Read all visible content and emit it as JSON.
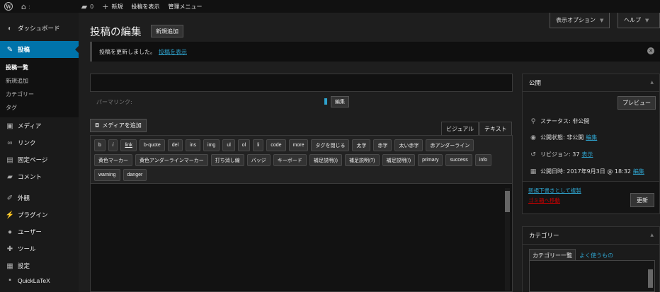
{
  "adminbar": {
    "home_icon": "home-icon",
    "colon": ":",
    "comments_count": "0",
    "new_label": "新規",
    "view_post_label": "投稿を表示",
    "admin_menu_label": "管理メニュー"
  },
  "sidebar": {
    "items_top": [
      {
        "label": "ダッシュボード",
        "icon": "dashboard-icon"
      }
    ],
    "active": {
      "label": "投稿",
      "icon": "pin-icon"
    },
    "sub": [
      {
        "label": "投稿一覧"
      },
      {
        "label": "新規追加"
      },
      {
        "label": "カテゴリー"
      },
      {
        "label": "タグ"
      }
    ],
    "items_mid": [
      {
        "label": "メディア",
        "icon": "media-icon"
      },
      {
        "label": "リンク",
        "icon": "link-icon"
      },
      {
        "label": "固定ページ",
        "icon": "page-icon"
      },
      {
        "label": "コメント",
        "icon": "comment-icon"
      }
    ],
    "items_bottom": [
      {
        "label": "外観",
        "icon": "brush-icon"
      },
      {
        "label": "プラグイン",
        "icon": "plugin-icon"
      },
      {
        "label": "ユーザー",
        "icon": "user-icon"
      },
      {
        "label": "ツール",
        "icon": "wrench-icon"
      },
      {
        "label": "設定",
        "icon": "settings-icon"
      }
    ],
    "cut_item": "QuickLaTeX"
  },
  "header": {
    "screen_options": "表示オプション",
    "help": "ヘルプ",
    "title": "投稿の編集",
    "add_new": "新規追加"
  },
  "notice": {
    "text": "投稿を更新しました。",
    "link": "投稿を表示"
  },
  "permalink": {
    "label": "パーマリンク:",
    "edit": "編集"
  },
  "editor": {
    "add_media": "メディアを追加",
    "tab_visual": "ビジュアル",
    "tab_text": "テキスト",
    "quicktags": [
      "b",
      "i",
      "link",
      "b-quote",
      "del",
      "ins",
      "img",
      "ul",
      "ol",
      "li",
      "code",
      "more",
      "タグを閉じる",
      "太字",
      "赤字",
      "太い赤字",
      "赤アンダーライン",
      "黄色マーカー",
      "黄色アンダーラインマーカー",
      "打ち消し線",
      "バッジ",
      "キーボード",
      "補足説明(i)",
      "補足説明(?)",
      "補足説明(!)",
      "primary",
      "success",
      "info",
      "warning",
      "danger"
    ]
  },
  "publish": {
    "title": "公開",
    "preview": "プレビュー",
    "status_label": "ステータス: 非公開",
    "visibility_label": "公開状態: 非公開",
    "visibility_edit": "編集",
    "revisions_label": "リビジョン: 37",
    "revisions_link": "表示",
    "date_label": "公開日時: 2017年9月3日 @ 18:32",
    "date_edit": "編集",
    "copy_draft": "新規下書きとして複製",
    "trash": "ゴミ箱へ移動",
    "update": "更新"
  },
  "categories": {
    "title": "カテゴリー",
    "tab_all": "カテゴリー一覧",
    "tab_popular": "よく使うもの"
  },
  "colors": {
    "accent": "#0073aa",
    "link": "#2ea2cc",
    "danger": "#cc0000"
  }
}
